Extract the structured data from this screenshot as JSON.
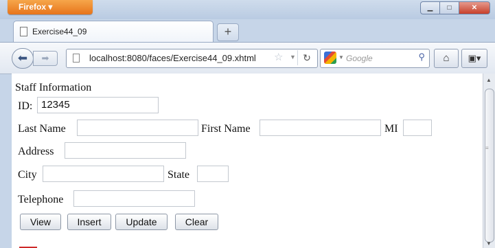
{
  "browser": {
    "app_menu_label": "Firefox ▾",
    "tab_title": "Exercise44_09",
    "new_tab_label": "+",
    "url": "localhost:8080/faces/Exercise44_09.xhtml",
    "search_placeholder": "Google"
  },
  "form": {
    "heading": "Staff Information",
    "id_label": "ID:",
    "id_value": "12345",
    "last_name_label": "Last Name",
    "first_name_label": "First Name",
    "mi_label": "MI",
    "address_label": "Address",
    "city_label": "City",
    "state_label": "State",
    "telephone_label": "Telephone",
    "buttons": {
      "view": "View",
      "insert": "Insert",
      "update": "Update",
      "clear": "Clear"
    }
  },
  "icons": {
    "back": "back-arrow-icon",
    "forward": "forward-arrow-icon",
    "bookmark": "star-icon",
    "reload": "reload-icon",
    "search": "magnifier-icon",
    "home": "home-icon",
    "bookmarks_menu": "bookmarks-icon"
  }
}
